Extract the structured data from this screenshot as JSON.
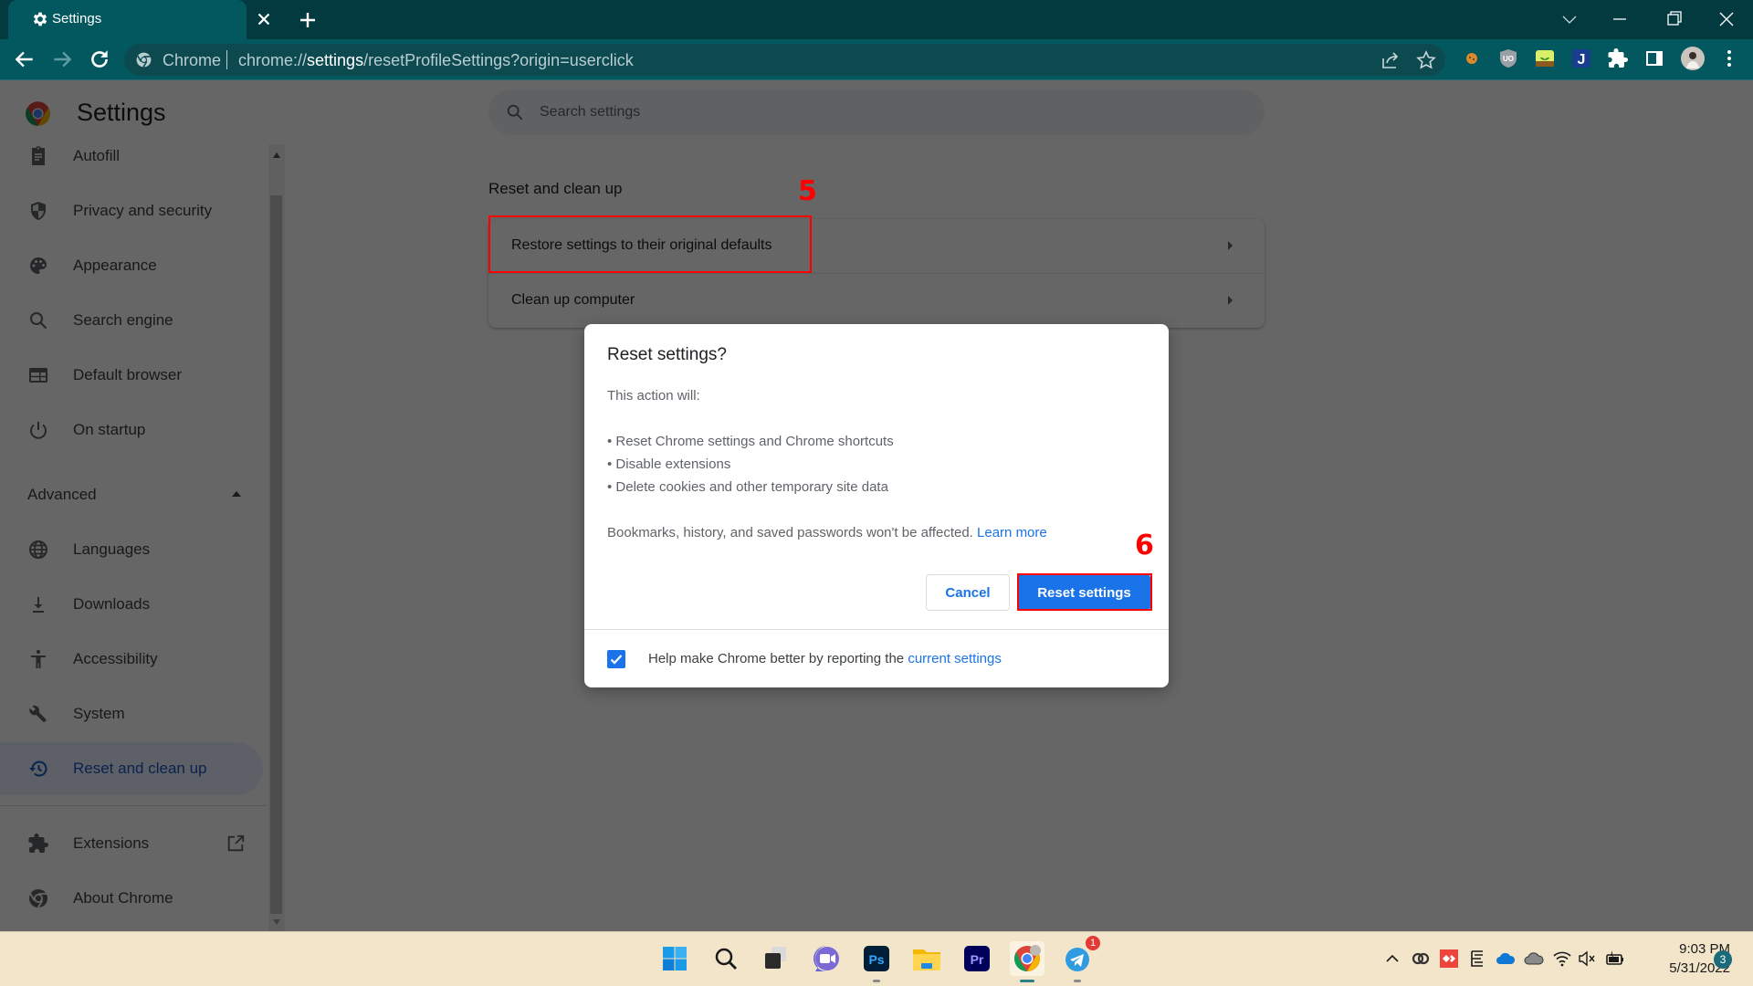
{
  "browser": {
    "tab_title": "Settings",
    "omnibox": {
      "site_name": "Chrome",
      "url_prefix": "chrome://",
      "url_host": "settings",
      "url_path": "/resetProfileSettings?origin=userclick"
    },
    "icons": {
      "tab": "gear-icon",
      "back": "arrow-left-icon",
      "forward": "arrow-right-icon",
      "reload": "reload-icon",
      "share": "share-icon",
      "bookmark": "star-icon",
      "extensions": [
        "cookie-extension-icon",
        "ublock-origin-icon",
        "forest-extension-icon",
        "j-extension-icon"
      ],
      "puzzle": "extensions-puzzle-icon",
      "side_panel": "side-panel-icon",
      "profile": "profile-avatar-icon",
      "menu": "kebab-menu-icon"
    }
  },
  "settings": {
    "title": "Settings",
    "search_placeholder": "Search settings",
    "sidebar": {
      "items_top": [
        {
          "label": "Autofill",
          "icon": "clipboard-icon"
        },
        {
          "label": "Privacy and security",
          "icon": "shield-icon"
        },
        {
          "label": "Appearance",
          "icon": "palette-icon"
        },
        {
          "label": "Search engine",
          "icon": "search-icon"
        },
        {
          "label": "Default browser",
          "icon": "browser-window-icon"
        },
        {
          "label": "On startup",
          "icon": "power-icon"
        }
      ],
      "advanced_label": "Advanced",
      "items_advanced": [
        {
          "label": "Languages",
          "icon": "globe-icon"
        },
        {
          "label": "Downloads",
          "icon": "download-icon"
        },
        {
          "label": "Accessibility",
          "icon": "accessibility-icon"
        },
        {
          "label": "System",
          "icon": "wrench-icon"
        },
        {
          "label": "Reset and clean up",
          "icon": "history-reset-icon",
          "active": true
        }
      ],
      "items_bottom": [
        {
          "label": "Extensions",
          "icon": "puzzle-icon",
          "trailing": "open-external-icon"
        },
        {
          "label": "About Chrome",
          "icon": "chrome-icon"
        }
      ]
    },
    "section": {
      "title": "Reset and clean up",
      "rows": [
        {
          "label": "Restore settings to their original defaults"
        },
        {
          "label": "Clean up computer"
        }
      ]
    }
  },
  "annotations": {
    "step_5": "5",
    "step_6": "6",
    "color": "#ff0000"
  },
  "dialog": {
    "title": "Reset settings?",
    "intro": "This action will:",
    "bullets": [
      "• Reset Chrome settings and Chrome shortcuts",
      "• Disable extensions",
      "• Delete cookies and other temporary site data"
    ],
    "note": "Bookmarks, history, and saved passwords won't be affected.",
    "learn_more": "Learn more",
    "cancel_label": "Cancel",
    "reset_label": "Reset settings",
    "checkbox_checked": true,
    "checkbox_label": "Help make Chrome better by reporting the",
    "checkbox_link": "current settings"
  },
  "taskbar": {
    "apps": [
      "windows-start-icon",
      "search-icon",
      "task-view-icon",
      "meet-chat-icon",
      "photoshop-icon",
      "file-explorer-icon",
      "premiere-pro-icon",
      "chrome-icon",
      "telegram-icon"
    ],
    "telegram_badge": "1",
    "tray": [
      "chevron-up-icon",
      "creative-cloud-icon",
      "anydesk-icon",
      "evernote-icon",
      "onedrive-icon",
      "onedrive-personal-icon",
      "wifi-icon",
      "volume-muted-icon",
      "battery-charging-icon"
    ],
    "time": "9:03 PM",
    "date": "5/31/2022",
    "notification_count": "3"
  },
  "colors": {
    "chrome_frame": "#033a40",
    "chrome_toolbar": "#03585f",
    "accent_blue": "#1a73e8",
    "annotation_red": "#ff0000"
  }
}
